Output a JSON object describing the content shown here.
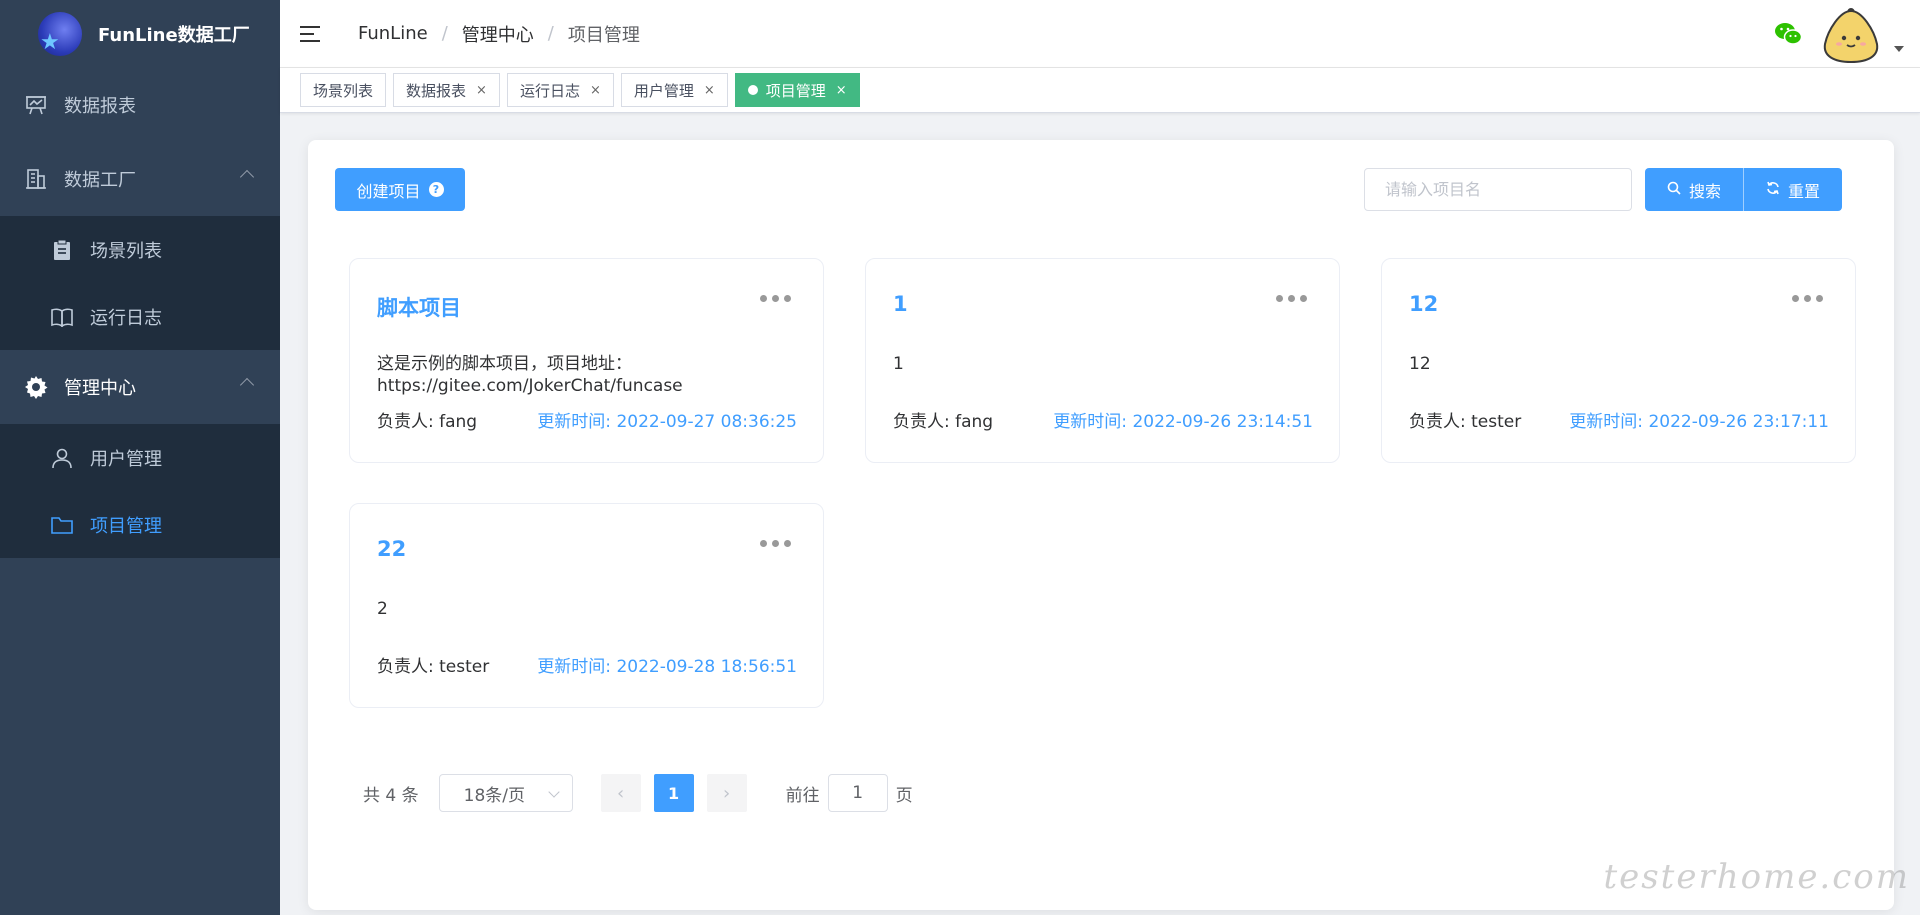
{
  "app": {
    "name": "FunLine数据工厂"
  },
  "sidebar": {
    "items": [
      {
        "label": "数据报表",
        "icon": "presentation-board-icon"
      },
      {
        "label": "数据工厂",
        "icon": "building-icon",
        "children": [
          {
            "label": "场景列表",
            "icon": "clipboard-icon"
          },
          {
            "label": "运行日志",
            "icon": "book-icon"
          }
        ]
      },
      {
        "label": "管理中心",
        "icon": "gear-icon",
        "children": [
          {
            "label": "用户管理",
            "icon": "user-icon"
          },
          {
            "label": "项目管理",
            "icon": "folder-icon",
            "active": true
          }
        ]
      }
    ]
  },
  "header": {
    "breadcrumb": [
      "FunLine",
      "管理中心",
      "项目管理"
    ],
    "separator": "/"
  },
  "tags": [
    {
      "label": "场景列表",
      "closable": false
    },
    {
      "label": "数据报表",
      "closable": true
    },
    {
      "label": "运行日志",
      "closable": true
    },
    {
      "label": "用户管理",
      "closable": true
    },
    {
      "label": "项目管理",
      "closable": true,
      "active": true
    }
  ],
  "tag_close": "×",
  "toolbar": {
    "create_label": "创建项目",
    "help_glyph": "?",
    "search_placeholder": "请输入项目名",
    "search_value": "",
    "search_label": "搜索",
    "reset_label": "重置"
  },
  "projects": [
    {
      "title": "脚本项目",
      "desc": "这是示例的脚本项目，项目地址：https://gitee.com/JokerChat/funcase",
      "owner": "负责人: fang",
      "updated": "更新时间: 2022-09-27 08:36:25"
    },
    {
      "title": "1",
      "desc": "1",
      "owner": "负责人: fang",
      "updated": "更新时间: 2022-09-26 23:14:51"
    },
    {
      "title": "12",
      "desc": "12",
      "owner": "负责人: tester",
      "updated": "更新时间: 2022-09-26 23:17:11"
    },
    {
      "title": "22",
      "desc": "2",
      "owner": "负责人: tester",
      "updated": "更新时间: 2022-09-28 18:56:51"
    }
  ],
  "pagination": {
    "total_label": "共 4 条",
    "page_size": "18条/页",
    "current_page": "1",
    "prev_glyph": "‹",
    "next_glyph": "›",
    "goto_label": "前往",
    "goto_value": "1",
    "page_suffix": "页"
  },
  "watermark": "testerhome.com",
  "colors": {
    "primary": "#409eff",
    "sidebar": "#304156",
    "submenu": "#1f2d3d",
    "tag_active": "#42b983"
  }
}
